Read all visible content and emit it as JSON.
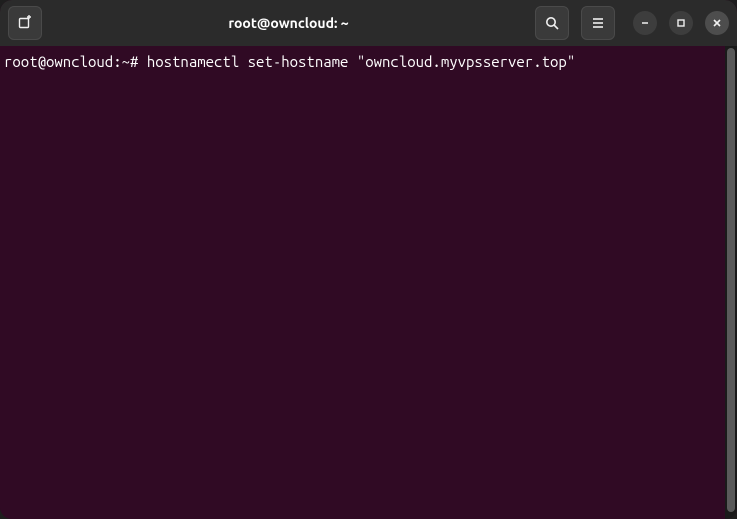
{
  "window": {
    "title": "root@owncloud: ~"
  },
  "terminal": {
    "prompt_userhost": "root@owncloud",
    "prompt_sep1": ":",
    "prompt_path": "~",
    "prompt_hash": "#",
    "command": "hostnamectl set-hostname \"owncloud.myvpsserver.top\""
  },
  "icons": {
    "new_tab": "new-tab-icon",
    "search": "search-icon",
    "menu": "hamburger-menu-icon",
    "minimize": "minimize-icon",
    "maximize": "maximize-icon",
    "close": "close-icon"
  }
}
